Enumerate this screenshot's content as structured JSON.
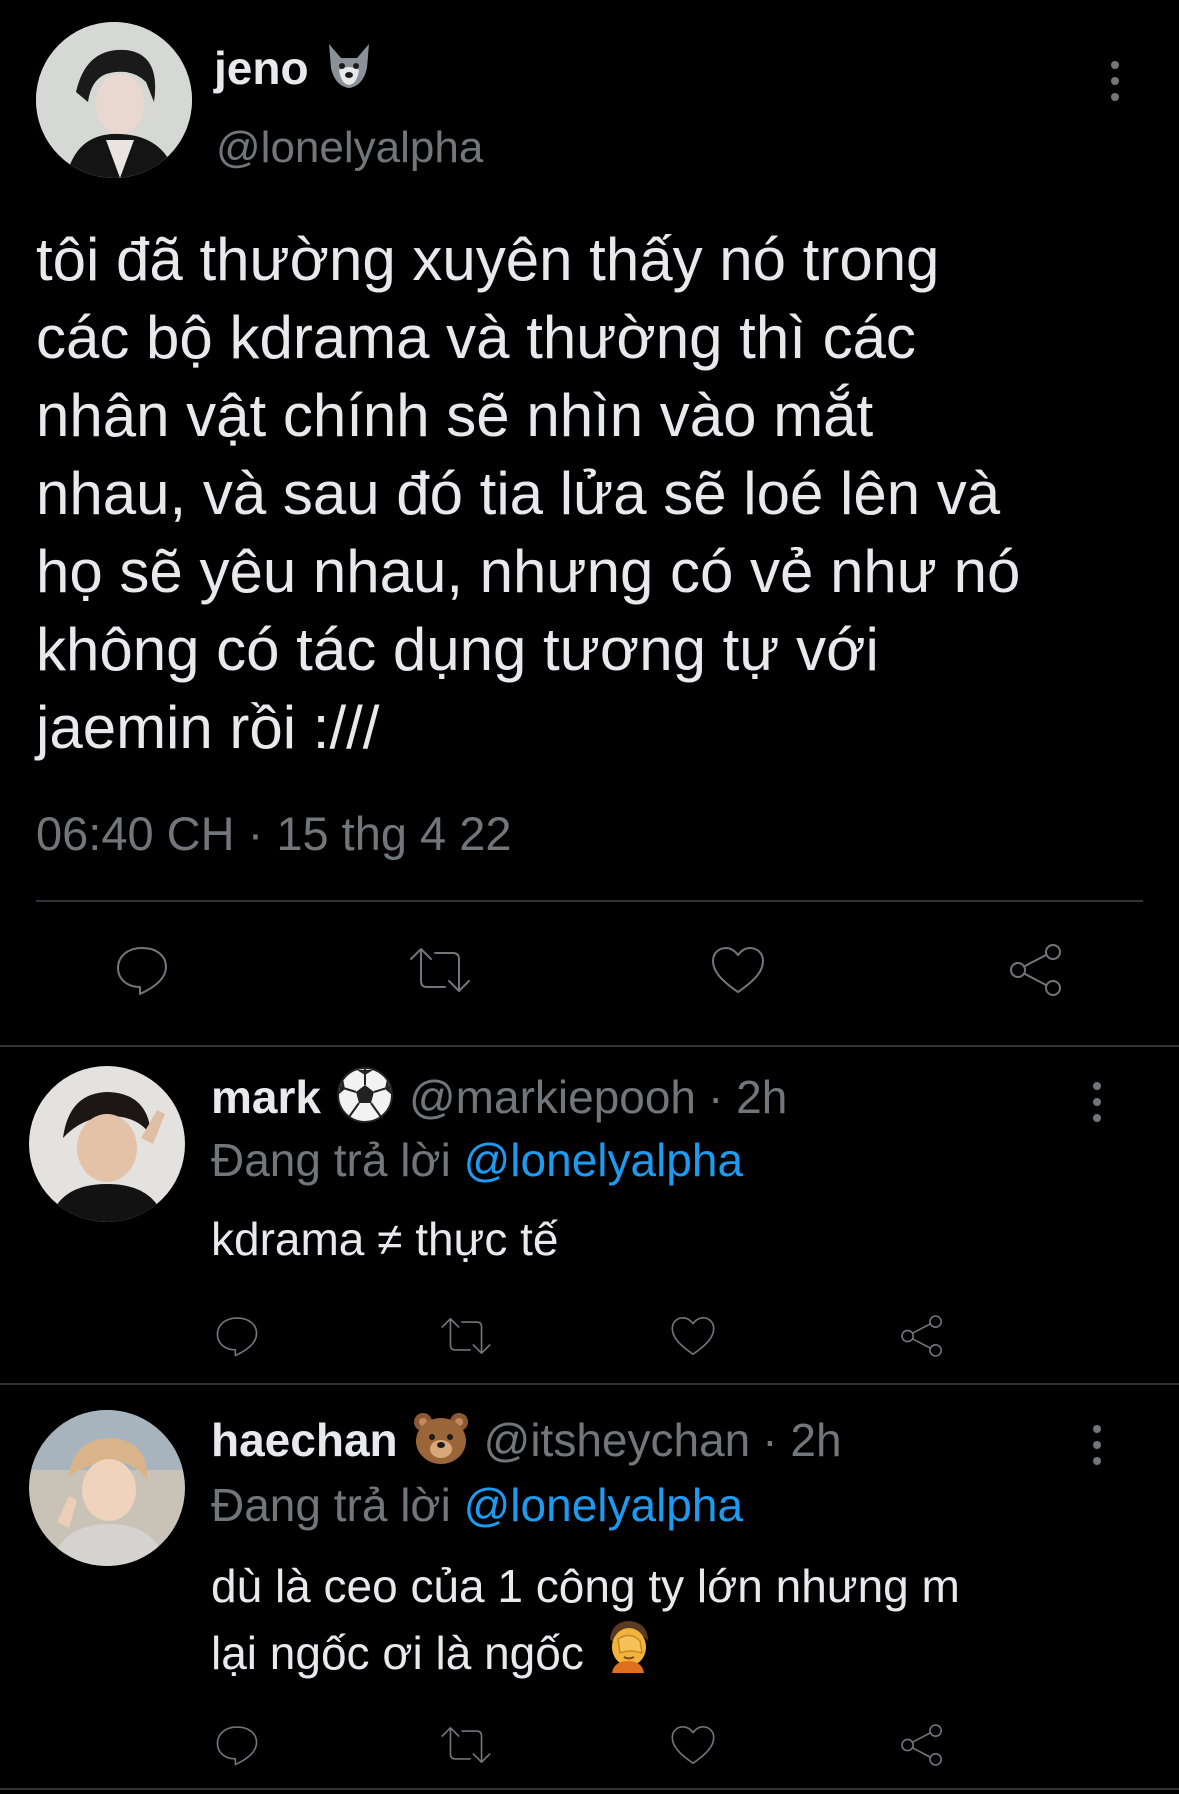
{
  "main_tweet": {
    "author_name": "jeno",
    "author_emoji": "wolf-emoji",
    "handle": "@lonelyalpha",
    "text": "tôi đã thường xuyên thấy nó trong các bộ kdrama và thường thì các nhân vật chính sẽ nhìn vào mắt nhau, và sau đó tia lửa sẽ loé lên và họ sẽ yêu nhau, nhưng có vẻ như nó không có tác dụng tương tự với jaemin rồi :///",
    "lines": [
      "tôi đã thường xuyên thấy nó trong",
      "các bộ kdrama và thường thì các",
      "nhân vật chính sẽ nhìn vào mắt",
      "nhau, và sau đó tia lửa sẽ loé lên và",
      "họ sẽ yêu nhau, nhưng có vẻ như nó",
      "không có tác dụng tương tự với",
      "jaemin rồi :///"
    ],
    "timestamp": "06:40 CH · 15 thg 4 22"
  },
  "replies": [
    {
      "author_name": "mark",
      "author_emoji": "soccer-ball-emoji",
      "handle": "@markiepooh",
      "time": "· 2h",
      "replying_prefix": "Đang trả lời",
      "replying_to": "@lonelyalpha",
      "lines": [
        "kdrama ≠ thực tế"
      ]
    },
    {
      "author_name": "haechan",
      "author_emoji": "bear-face-emoji",
      "handle": "@itsheychan",
      "time": "· 2h",
      "replying_prefix": "Đang trả lời",
      "replying_to": "@lonelyalpha",
      "lines": [
        "dù là ceo của 1 công ty lớn nhưng m",
        "lại ngốc ơi là ngốc"
      ],
      "trailing_emoji": "facepalm-emoji"
    }
  ],
  "actions": [
    "reply-icon",
    "retweet-icon",
    "like-icon",
    "share-icon"
  ],
  "colors": {
    "background": "#000000",
    "text": "#e7e9ea",
    "muted": "#71767b",
    "link": "#1d9bf0",
    "divider": "#2f3336"
  }
}
